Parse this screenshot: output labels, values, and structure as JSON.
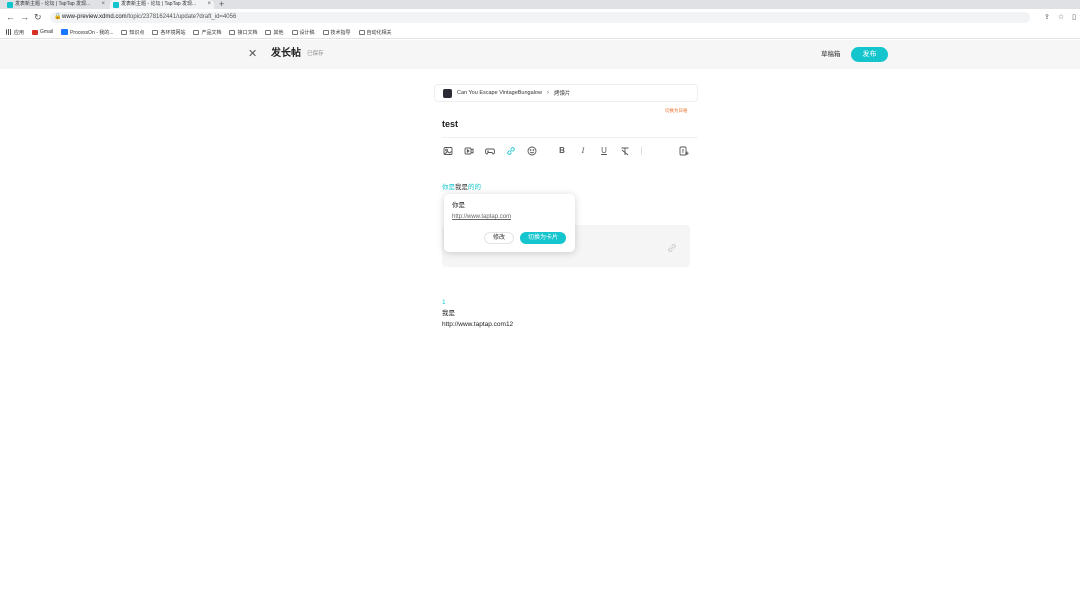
{
  "browser": {
    "tabs": [
      {
        "label": "发表新主题 - 论坛 | TapTap 发现..."
      },
      {
        "label": "发表新主题 - 论坛 | TapTap 发现..."
      }
    ],
    "tab_add": "+",
    "url_host": "www-preview.xdmd.com",
    "url_path": "/topic/2378162441/update?draft_id=4056",
    "bookmarks": [
      "应用",
      "Gmail",
      "ProcessOn - 我的...",
      "知识点",
      "各环境网站",
      "产品文档",
      "接口文档",
      "其他",
      "设计稿",
      "技术指导",
      "自动化相关"
    ]
  },
  "header": {
    "close_glyph": "✕",
    "title": "发长帖",
    "saved_status": "已保存",
    "drafts_label": "草稿箱",
    "publish_label": "发布"
  },
  "editor": {
    "game_name": "Can You Escape VintageBungalow",
    "game_section": "烤馍片",
    "switch_label": "切换为日格",
    "post_title": "test",
    "link_text_before": "你是",
    "link_text_mid": "我是",
    "link_text_after": "的的",
    "popover": {
      "title": "你是",
      "url": "http://www.taptap.com",
      "edit_label": "修改",
      "card_label": "切换为卡片"
    },
    "body_lines": [
      "1",
      "我是",
      "http://www.taptap.com12"
    ]
  },
  "colors": {
    "accent": "#15c5ce",
    "warning_link": "#e8722a"
  }
}
